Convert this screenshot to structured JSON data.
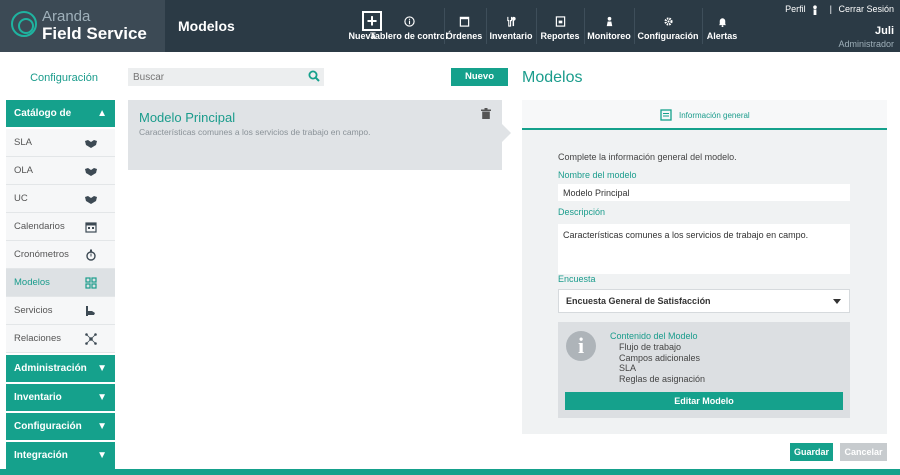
{
  "app": {
    "logo_line1": "Aranda",
    "logo_line2": "Field Service",
    "module_title": "Modelos"
  },
  "nav": [
    {
      "label": "Nueva",
      "icon": "plus-icon"
    },
    {
      "label": "Tablero de control",
      "icon": "info-circle-icon"
    },
    {
      "label": "Órdenes",
      "icon": "clipboard-icon"
    },
    {
      "label": "Inventario",
      "icon": "tools-icon"
    },
    {
      "label": "Reportes",
      "icon": "report-icon"
    },
    {
      "label": "Monitoreo",
      "icon": "person-pin-icon"
    },
    {
      "label": "Configuración",
      "icon": "gear-icon"
    },
    {
      "label": "Alertas",
      "icon": "bell-icon"
    }
  ],
  "user": {
    "profile_label": "Perfil",
    "separator": "|",
    "logout_label": "Cerrar Sesión",
    "name": "Juli",
    "role": "Administrador"
  },
  "sidebar": {
    "title": "Configuración",
    "catalog_group": "Catálogo de servicios",
    "items": [
      {
        "label": "SLA",
        "icon": "handshake-icon"
      },
      {
        "label": "OLA",
        "icon": "handshake-icon"
      },
      {
        "label": "UC",
        "icon": "handshake-icon"
      },
      {
        "label": "Calendarios",
        "icon": "calendar-icon"
      },
      {
        "label": "Cronómetros",
        "icon": "stopwatch-icon"
      },
      {
        "label": "Modelos",
        "icon": "models-icon"
      },
      {
        "label": "Servicios",
        "icon": "hand-service-icon"
      },
      {
        "label": "Relaciones",
        "icon": "network-icon"
      }
    ],
    "groups": [
      "Administración",
      "Inventario",
      "Configuración",
      "Integración"
    ]
  },
  "list": {
    "search_placeholder": "Buscar",
    "new_button": "Nuevo",
    "card_title": "Modelo Principal",
    "card_desc": "Características comunes a los servicios de trabajo en campo."
  },
  "detail": {
    "title": "Modelos",
    "tab_label": "Información general",
    "intro": "Complete la información general del modelo.",
    "name_label": "Nombre del modelo",
    "name_value": "Modelo Principal",
    "desc_label": "Descripción",
    "desc_value": "Características comunes a los servicios de trabajo en campo.",
    "survey_label": "Encuesta",
    "survey_value": "Encuesta General de Satisfacción",
    "info_title": "Contenido del Modelo",
    "info_items": [
      "Flujo de trabajo",
      "Campos adicionales",
      "SLA",
      "Reglas de asignación"
    ],
    "edit_button": "Editar Modelo"
  },
  "actions": {
    "save": "Guardar",
    "cancel": "Cancelar"
  },
  "colors": {
    "accent": "#15a18c",
    "topbar": "#2b3a45"
  }
}
